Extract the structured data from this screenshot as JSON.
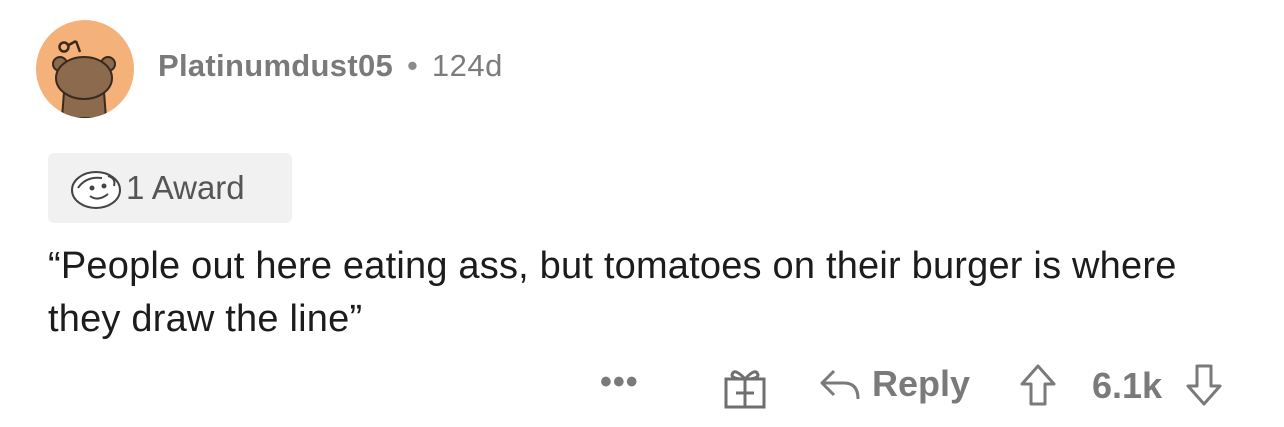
{
  "comment": {
    "author": "Platinumdust05",
    "separator": "•",
    "age": "124d",
    "award": {
      "count_label": "1 Award",
      "icon": "award-face-icon"
    },
    "body": "“People out here eating ass, but tomatoes on their burger is where they draw the line”",
    "actions": {
      "more_label": "•••",
      "gift_icon": "gift-icon",
      "reply_label": "Reply",
      "score": "6.1k"
    }
  },
  "colors": {
    "avatar_bg": "#f4b27a",
    "avatar_figure": "#8b6a4d",
    "muted_text": "#7c7c7c",
    "body_text": "#1c1c1c",
    "award_bg": "#f1f1f1"
  }
}
